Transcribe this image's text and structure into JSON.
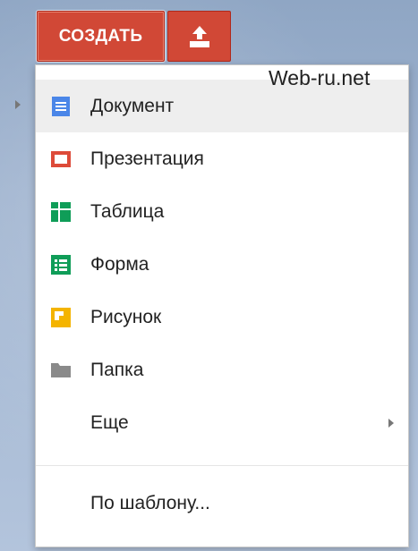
{
  "toolbar": {
    "create_label": "СОЗДАТЬ",
    "upload_icon": "upload-icon"
  },
  "watermark": "Web-ru.net",
  "menu": {
    "items": [
      {
        "label": "Документ",
        "icon": "document-icon",
        "color": "#4a86e8"
      },
      {
        "label": "Презентация",
        "icon": "presentation-icon",
        "color": "#dd4b39"
      },
      {
        "label": "Таблица",
        "icon": "spreadsheet-icon",
        "color": "#0f9d58"
      },
      {
        "label": "Форма",
        "icon": "form-icon",
        "color": "#0f9d58"
      },
      {
        "label": "Рисунок",
        "icon": "drawing-icon",
        "color": "#f4b400"
      },
      {
        "label": "Папка",
        "icon": "folder-icon",
        "color": "#8a8a8a"
      },
      {
        "label": "Еще"
      },
      {
        "label": "По шаблону..."
      }
    ]
  },
  "colors": {
    "accent_red": "#d14836",
    "highlight": "#eeeeee"
  }
}
